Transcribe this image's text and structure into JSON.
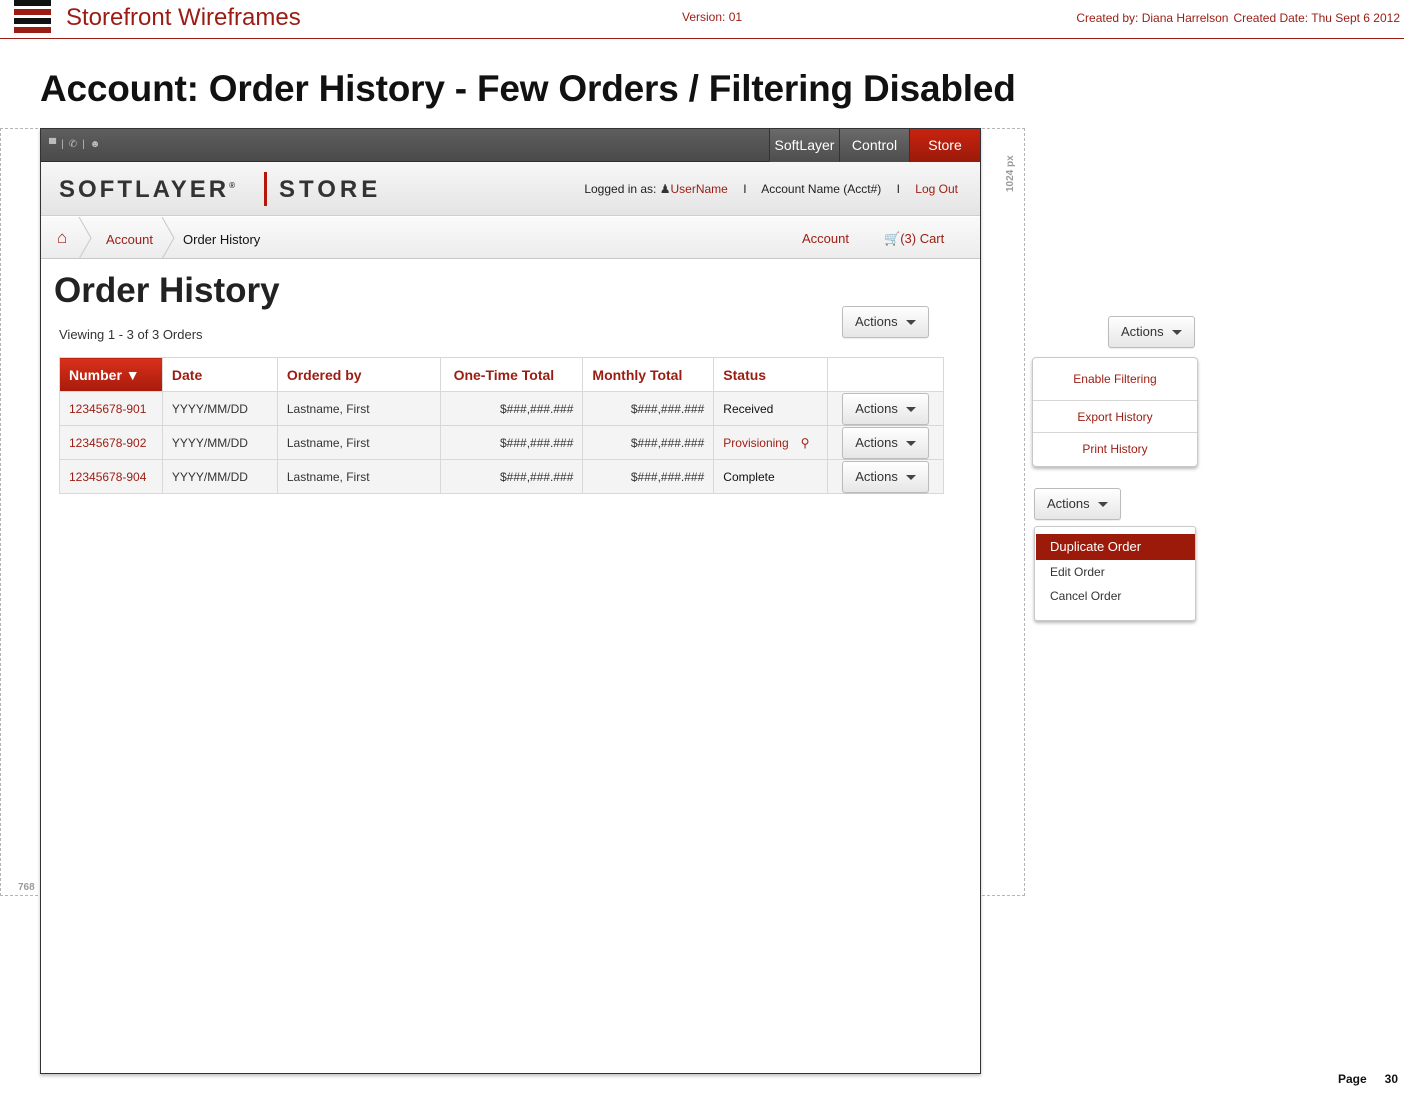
{
  "doc": {
    "title": "Storefront Wireframes",
    "version": "Version: 01",
    "created_by": "Created by: Diana Harrelson",
    "created_date": "Created Date: Thu Sept 6 2012",
    "page_title": "Account: Order History - Few Orders / Filtering Disabled",
    "guide_width": "1024 px",
    "guide_height": "768",
    "page_label": "Page",
    "page_number": "30",
    "colors": {
      "brand_red": "#9b1c12",
      "store_tab": "#c8230f",
      "menu_selected": "#9b1a0a"
    }
  },
  "topbar": {
    "icons": [
      "chat-icon",
      "phone-icon",
      "users-icon"
    ],
    "tabs": [
      "SoftLayer",
      "Control",
      "Store"
    ],
    "active_tab": "Store"
  },
  "masthead": {
    "brand": "SOFTLAYER",
    "brand_mark": "®",
    "store": "STORE",
    "logged_in_label": "Logged in as:",
    "username": "UserName",
    "account_name": "Account Name (Acct#)",
    "logout": "Log Out",
    "separator": "I"
  },
  "breadcrumb": {
    "items": [
      "Account",
      "Order History"
    ],
    "right_account": "Account",
    "cart": "(3) Cart"
  },
  "content": {
    "title": "Order History",
    "viewing": "Viewing 1 - 3 of 3 Orders",
    "actions_label": "Actions"
  },
  "table": {
    "columns": [
      "Number ▼",
      "Date",
      "Ordered by",
      "One-Time Total",
      "Monthly Total",
      "Status",
      ""
    ],
    "rows": [
      {
        "number": "12345678-901",
        "date": "YYYY/MM/DD",
        "ordered_by": "Lastname, First",
        "one_time": "$###,###.###",
        "monthly": "$###,###.###",
        "status": "Received",
        "action": "Actions"
      },
      {
        "number": "12345678-902",
        "date": "YYYY/MM/DD",
        "ordered_by": "Lastname, First",
        "one_time": "$###,###.###",
        "monthly": "$###,###.###",
        "status": "Provisioning",
        "action": "Actions"
      },
      {
        "number": "12345678-904",
        "date": "YYYY/MM/DD",
        "ordered_by": "Lastname, First",
        "one_time": "$###,###.###",
        "monthly": "$###,###.###",
        "status": "Complete",
        "action": "Actions"
      }
    ]
  },
  "side_menu_page": {
    "button": "Actions",
    "items": [
      "Enable Filtering",
      "Export History",
      "Print History"
    ]
  },
  "side_menu_row": {
    "button": "Actions",
    "selected": "Duplicate Order",
    "items": [
      "Edit Order",
      "Cancel Order"
    ]
  }
}
